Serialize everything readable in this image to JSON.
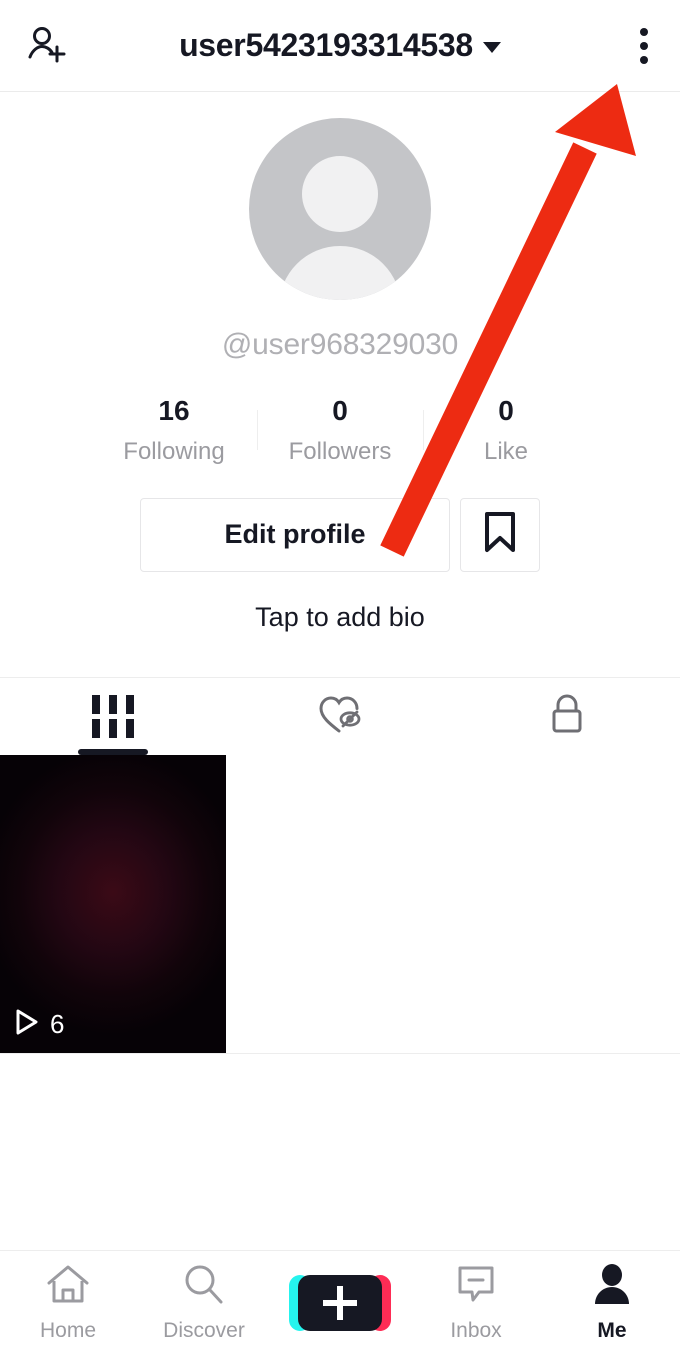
{
  "header": {
    "add_friend_icon": "add-person-icon",
    "title": "user5423193314538",
    "dropdown_icon": "chevron-down-icon",
    "more_icon": "three-dots-vertical-icon"
  },
  "profile": {
    "avatar_icon": "default-avatar-placeholder",
    "handle": "@user968329030",
    "bio_placeholder": "Tap to add bio",
    "stats": [
      {
        "value": "16",
        "label": "Following"
      },
      {
        "value": "0",
        "label": "Followers"
      },
      {
        "value": "0",
        "label": "Like"
      }
    ],
    "edit_profile_label": "Edit profile",
    "bookmark_icon": "bookmark-icon"
  },
  "tabs": [
    {
      "name": "videos",
      "icon": "grid-icon",
      "active": true
    },
    {
      "name": "liked-hidden",
      "icon": "heart-hidden-icon",
      "active": false
    },
    {
      "name": "private",
      "icon": "lock-icon",
      "active": false
    }
  ],
  "videos": [
    {
      "play_icon": "play-icon",
      "views": "6"
    }
  ],
  "bottom_nav": [
    {
      "label": "Home",
      "icon": "home-icon",
      "active": false
    },
    {
      "label": "Discover",
      "icon": "search-icon",
      "active": false
    },
    {
      "label": "",
      "icon": "create-plus-icon",
      "active": false
    },
    {
      "label": "Inbox",
      "icon": "inbox-message-icon",
      "active": false
    },
    {
      "label": "Me",
      "icon": "person-icon",
      "active": true
    }
  ],
  "annotation": {
    "type": "arrow",
    "color": "#ED2B12",
    "points_to": "three-dots-vertical-icon"
  },
  "colors": {
    "text_primary": "#161823",
    "text_muted": "#9b9ba0",
    "accent_cyan": "#25f4ee",
    "accent_pink": "#fe2c55",
    "annotation_red": "#ED2B12"
  }
}
